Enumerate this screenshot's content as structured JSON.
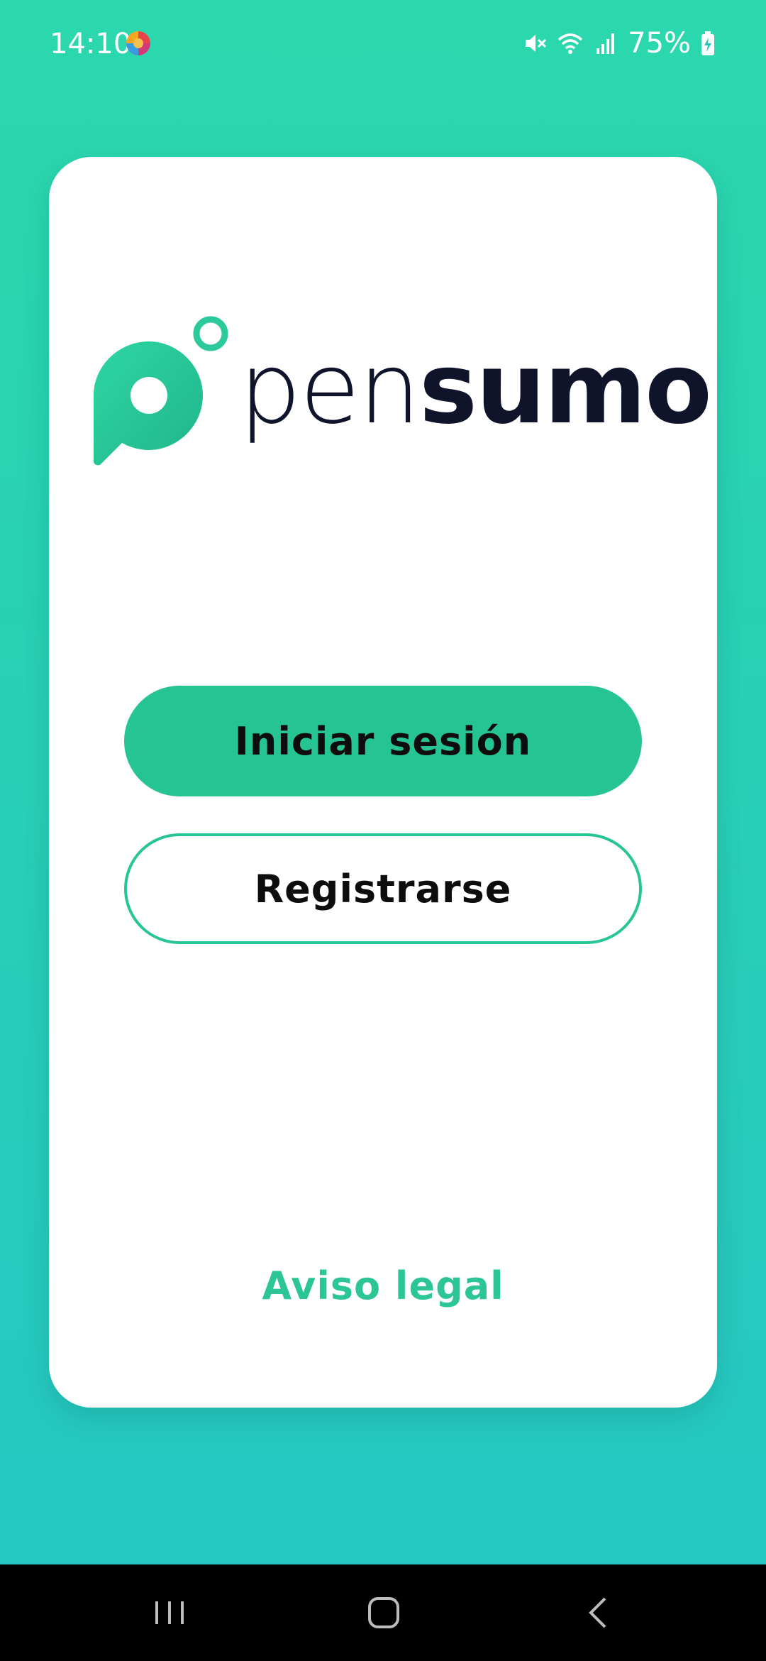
{
  "status_bar": {
    "time": "14:10",
    "battery": "75%",
    "app_icon": "colorful-circle-app-icon",
    "icons": [
      "mute-icon",
      "wifi-icon",
      "signal-icon",
      "battery-charging-icon"
    ]
  },
  "logo": {
    "text_light": "pen",
    "text_bold": "sumo",
    "icon": "speech-bubble-logo-icon",
    "brand_color": "#26c492"
  },
  "buttons": {
    "login": "Iniciar sesión",
    "register": "Registrarse"
  },
  "footer": {
    "legal": "Aviso legal"
  },
  "nav_bar": {
    "icons": [
      "recents-icon",
      "home-icon",
      "back-icon"
    ]
  },
  "colors": {
    "background_top": "#2bd8ad",
    "background_bottom": "#25c6c4",
    "accent": "#26c492",
    "text_dark": "#10142b"
  }
}
